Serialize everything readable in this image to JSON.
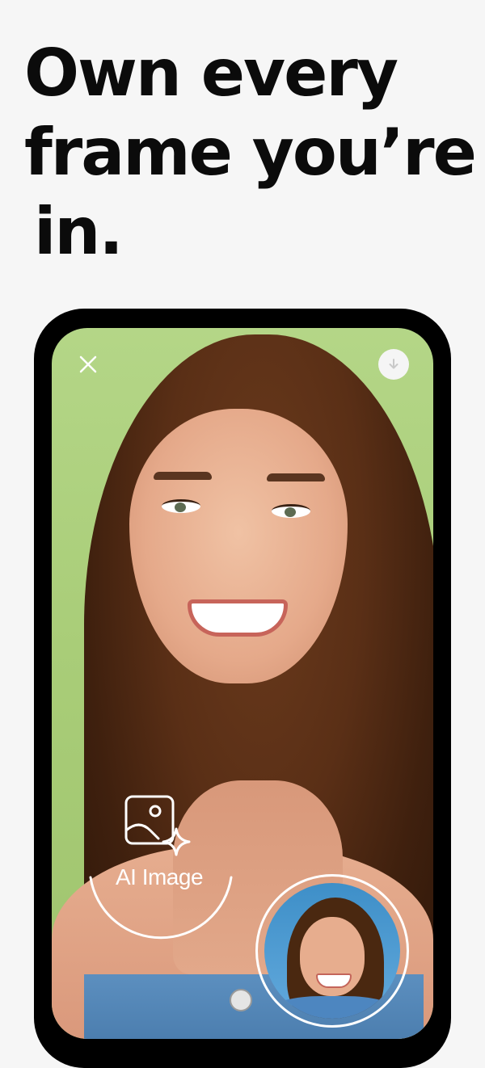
{
  "headline": {
    "line1": "Own every",
    "line2": "frame you’re",
    "line3": "in."
  },
  "screen": {
    "close_icon": "close-icon",
    "download_icon": "download-icon",
    "ai_image": {
      "label": "AI Image",
      "icon": "ai-image-sparkle-icon"
    },
    "selfie_icon": "selfie-thumbnail"
  },
  "colors": {
    "background": "#f6f6f6",
    "headline": "#0b0b0b",
    "phone_frame": "#000000",
    "photo_bg": "#b4d687",
    "overlay": "#ffffff"
  }
}
